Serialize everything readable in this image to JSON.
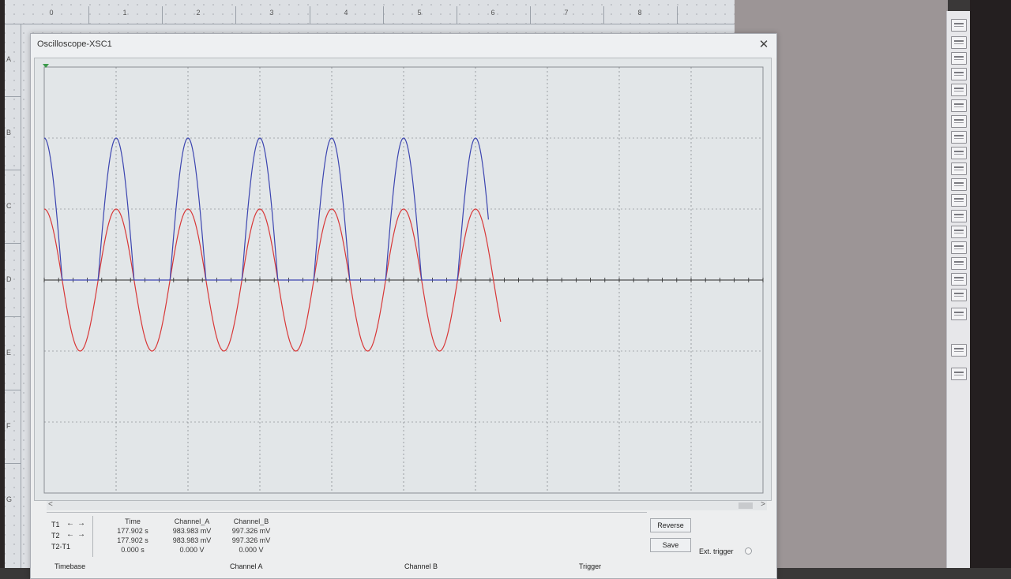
{
  "ruler": {
    "top_numbers": [
      "0",
      "1",
      "2",
      "3",
      "4",
      "5",
      "6",
      "7",
      "8"
    ],
    "left_letters": [
      "A",
      "B",
      "C",
      "D",
      "E",
      "F",
      "G"
    ]
  },
  "window": {
    "title": "Oscilloscope-XSC1",
    "close_symbol": "✕"
  },
  "colors": {
    "channel_a": "#d83838",
    "channel_b": "#3c45b0",
    "grid": "#6b6f74",
    "axis": "#2a2a2a",
    "screen_bg": "#e2e6e8"
  },
  "chart_data": {
    "type": "line",
    "xlim": [
      0,
      10
    ],
    "ylim": [
      -3,
      3
    ],
    "x_divisions": 10,
    "y_divisions": 6,
    "grid": true,
    "series": [
      {
        "color": "#d83838",
        "shape": "sine",
        "amplitude": 1,
        "period": 1,
        "x_start": 0,
        "x_end": 6.35
      },
      {
        "color": "#3c45b0",
        "shape": "half-wave-rectified-sine",
        "amplitude": 2,
        "period": 1,
        "x_start": 0,
        "x_end": 6.18
      }
    ]
  },
  "readout": {
    "rows": [
      "T1",
      "T2",
      "T2-T1"
    ],
    "left_arrow": "←",
    "right_arrow": "→",
    "headers": [
      "Time",
      "Channel_A",
      "Channel_B"
    ],
    "values": [
      [
        "177.902 s",
        "983.983 mV",
        "997.326 mV"
      ],
      [
        "177.902 s",
        "983.983 mV",
        "997.326 mV"
      ],
      [
        "0.000 s",
        "0.000 V",
        "0.000 V"
      ]
    ]
  },
  "buttons": {
    "reverse": "Reverse",
    "save": "Save",
    "ext_trigger": "Ext. trigger"
  },
  "sections": [
    "Timebase",
    "Channel A",
    "Channel B",
    "Trigger"
  ],
  "scroll": {
    "left_arrow": "<",
    "right_arrow": ">"
  }
}
